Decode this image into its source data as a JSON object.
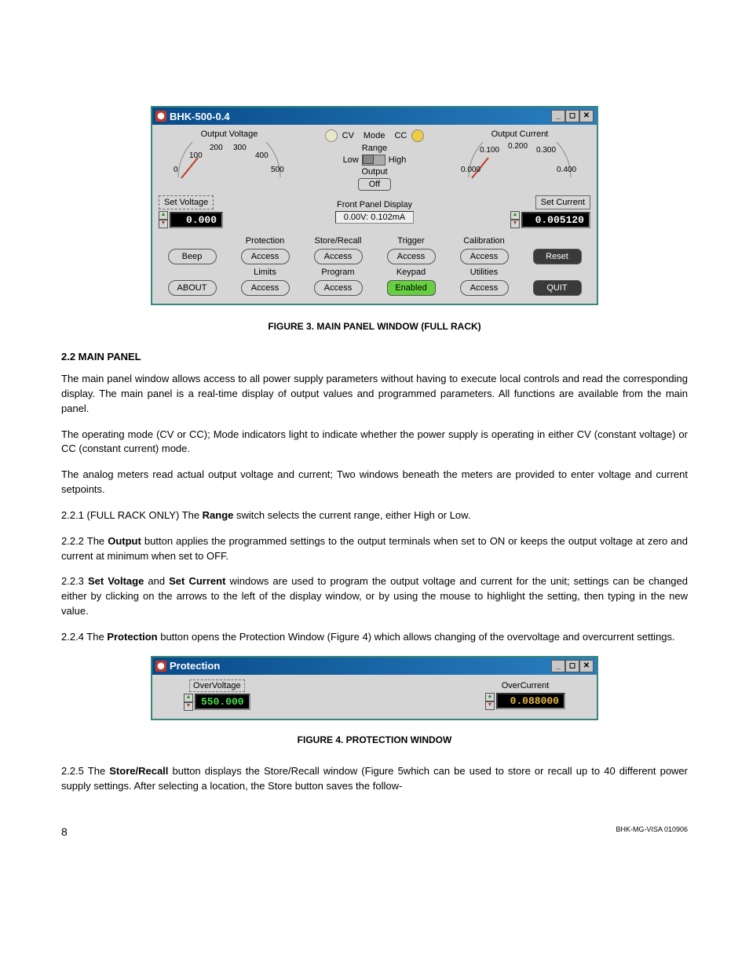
{
  "main_panel": {
    "title": "BHK-500-0.4",
    "win_buttons": {
      "min": "_",
      "max": "◻",
      "close": "✕"
    },
    "voltage": {
      "label": "Output Voltage",
      "ticks": [
        "0",
        "100",
        "200",
        "300",
        "400",
        "500"
      ],
      "set_btn": "Set Voltage",
      "value": "0.000"
    },
    "mode": {
      "cv": "CV",
      "label": "Mode",
      "cc": "CC",
      "range_label": "Range",
      "range_low": "Low",
      "range_high": "High",
      "output_label": "Output",
      "output_state": "Off"
    },
    "current": {
      "label": "Output Current",
      "ticks": [
        "0.000",
        "0.100",
        "0.200",
        "0.300",
        "0.400"
      ],
      "set_btn": "Set Current",
      "value": "0.005120"
    },
    "fpd": {
      "label": "Front Panel Display",
      "value": "0.00V: 0.102mA"
    },
    "col_labels": {
      "r1": [
        "",
        "Protection",
        "Store/Recall",
        "Trigger",
        "Calibration",
        ""
      ],
      "r3": [
        "",
        "Limits",
        "Program",
        "Keypad",
        "Utilities",
        ""
      ]
    },
    "buttons": {
      "beep": "Beep",
      "access": "Access",
      "reset": "Reset",
      "about": "ABOUT",
      "enabled": "Enabled",
      "quit": "QUIT"
    }
  },
  "captions": {
    "fig3": "FIGURE 3.    MAIN PANEL WINDOW (FULL RACK)",
    "fig4": "FIGURE 4.    PROTECTION WINDOW"
  },
  "headings": {
    "s22": "2.2  MAIN PANEL"
  },
  "paragraphs": {
    "p1": "The main panel window allows access to all power supply parameters without having to execute local controls and read the corresponding display. The main panel is a real-time display of output values and programmed parameters. All functions are available from the main panel.",
    "p2": "The operating mode (CV or CC); Mode indicators light to indicate whether the power supply is operating in either CV (constant voltage) or CC (constant current) mode.",
    "p3": "The analog meters read actual output voltage and current; Two windows beneath the meters are provided to enter voltage and current setpoints.",
    "p4_a": "2.2.1    (FULL RACK ONLY) The ",
    "p4_b": "Range",
    "p4_c": " switch selects the current range, either High or Low.",
    "p5_a": "2.2.2    The ",
    "p5_b": "Output",
    "p5_c": " button applies the programmed settings to the output terminals when set to ON or keeps the output voltage at zero and current at minimum when set to OFF.",
    "p6_a": "2.2.3    ",
    "p6_b": "Set Voltage",
    "p6_c": " and ",
    "p6_d": "Set Current",
    "p6_e": " windows are used to program the output voltage and current for the unit; settings can be changed either by clicking on the arrows to the left of the display window, or by using the mouse to highlight the setting, then typing in the new value.",
    "p7_a": "2.2.4    The ",
    "p7_b": "Protection",
    "p7_c": " button opens the Protection Window (Figure 4) which allows changing of the overvoltage and overcurrent settings.",
    "p8_a": "2.2.5    The ",
    "p8_b": "Store/Recall",
    "p8_c": " button displays the Store/Recall window  (Figure 5which can be used to store or recall up to 40 different power supply settings. After selecting a location, the Store button saves the follow-"
  },
  "protection": {
    "title": "Protection",
    "ov_label": "OverVoltage",
    "ov_value": "550.000",
    "oc_label": "OverCurrent",
    "oc_value": "0.088000"
  },
  "footer": {
    "page": "8",
    "docid": "BHK-MG-VISA 010906"
  }
}
